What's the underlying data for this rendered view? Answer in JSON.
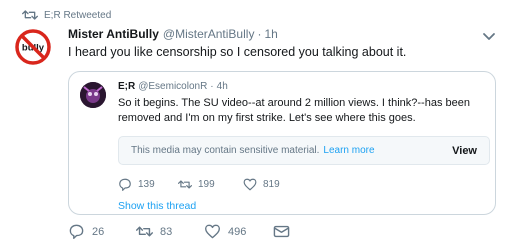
{
  "retweet": {
    "label": "E;R Retweeted",
    "icon": "retweet-icon"
  },
  "tweet": {
    "display_name": "Mister AntiBully",
    "handle": "@MisterAntiBully",
    "separator": "·",
    "time": "1h",
    "avatar_text": "bully",
    "text": "I heard you like censorship so I censored you talking about it.",
    "actions": {
      "replies": "26",
      "retweets": "83",
      "likes": "496"
    }
  },
  "quoted": {
    "display_name": "E;R",
    "handle": "@EsemicolonR",
    "separator": "·",
    "time": "4h",
    "text": "So it begins. The SU video--at around 2 million views. I think?--has been removed and I'm on my first strike. Let's see where this goes.",
    "sensitive_notice": "This media may contain sensitive material.",
    "learn_more": "Learn more",
    "view_label": "View",
    "actions": {
      "replies": "139",
      "retweets": "199",
      "likes": "819"
    },
    "show_thread": "Show this thread"
  },
  "colors": {
    "accent": "#1da1f2",
    "muted": "#657786",
    "text": "#14171a",
    "border": "#ccd6dd",
    "no_sign_red": "#d9261c"
  }
}
